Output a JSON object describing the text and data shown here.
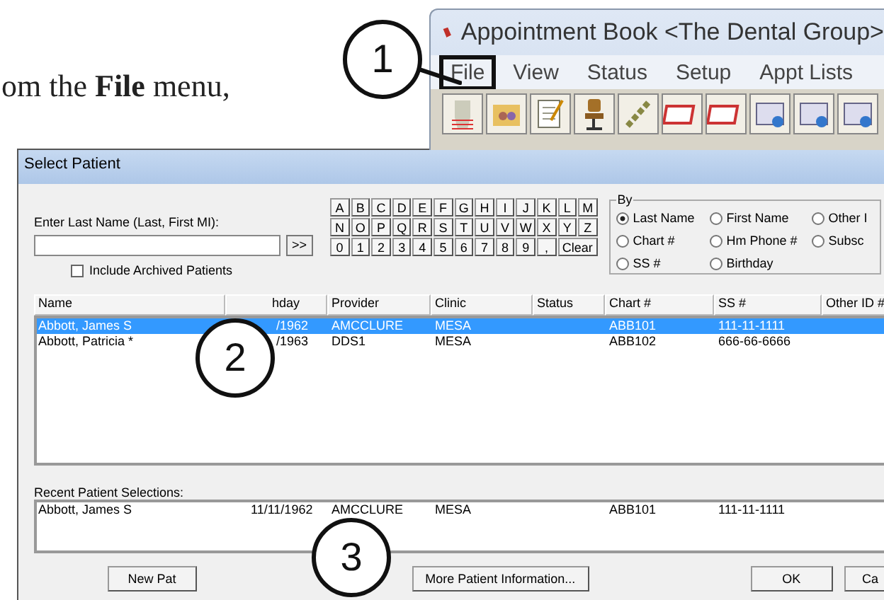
{
  "instruction_text": "om the **File** menu,",
  "app_window": {
    "title": "Appointment Book <The Dental Group>",
    "menu": [
      {
        "label": "File",
        "highlighted": true
      },
      {
        "label": "View",
        "highlighted": false
      },
      {
        "label": "Status",
        "highlighted": false
      },
      {
        "label": "Setup",
        "highlighted": false
      },
      {
        "label": "Appt Lists",
        "highlighted": false
      }
    ]
  },
  "callouts": [
    "1",
    "2",
    "3"
  ],
  "dialog": {
    "title": "Select Patient",
    "name_label": "Enter Last Name (Last, First MI):",
    "search_button": ">>",
    "archived": {
      "label": "Include Archived Patients",
      "checked": false
    },
    "letters": [
      [
        "A",
        "B",
        "C",
        "D",
        "E",
        "F",
        "G",
        "H",
        "I",
        "J",
        "K",
        "L",
        "M"
      ],
      [
        "N",
        "O",
        "P",
        "Q",
        "R",
        "S",
        "T",
        "U",
        "V",
        "W",
        "X",
        "Y",
        "Z"
      ],
      [
        "0",
        "1",
        "2",
        "3",
        "4",
        "5",
        "6",
        "7",
        "8",
        "9",
        ","
      ]
    ],
    "clear_button": "Clear",
    "by": {
      "legend": "By",
      "options": [
        {
          "label": "Last Name",
          "selected": true
        },
        {
          "label": "First Name",
          "selected": false
        },
        {
          "label": "Other I",
          "selected": false
        },
        {
          "label": "Chart #",
          "selected": false
        },
        {
          "label": "Hm Phone #",
          "selected": false
        },
        {
          "label": "Subsc",
          "selected": false
        },
        {
          "label": "SS #",
          "selected": false
        },
        {
          "label": "Birthday",
          "selected": false
        }
      ]
    },
    "columns": [
      "Name",
      "hday",
      "Provider",
      "Clinic",
      "Status",
      "Chart #",
      "SS #",
      "Other ID #"
    ],
    "rows": [
      {
        "selected": true,
        "cells": [
          "Abbott, James S",
          "/1962",
          "AMCCLURE",
          "MESA",
          "",
          "ABB101",
          "111-11-1111",
          ""
        ]
      },
      {
        "selected": false,
        "cells": [
          "Abbott, Patricia *",
          "/1963",
          "DDS1",
          "MESA",
          "",
          "ABB102",
          "666-66-6666",
          ""
        ]
      }
    ],
    "recent_label": "Recent Patient Selections:",
    "recent_rows": [
      {
        "cells": [
          "Abbott, James S",
          "11/11/1962",
          "AMCCLURE",
          "MESA",
          "",
          "ABB101",
          "111-11-1111",
          ""
        ]
      }
    ],
    "buttons": [
      "New Pat",
      "More Patient Information...",
      "OK",
      "Ca"
    ]
  }
}
